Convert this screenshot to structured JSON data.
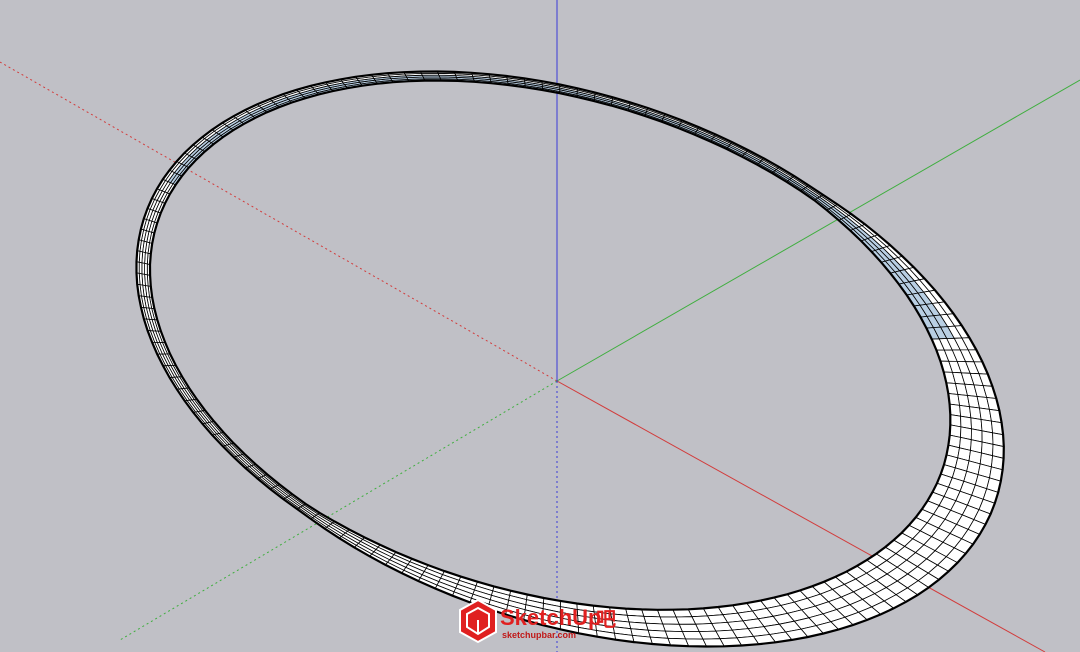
{
  "viewport": {
    "background": "#c0c0c6"
  },
  "axes": {
    "red": "#d23c3c",
    "green": "#3fae3f",
    "blue": "#3a3ad8"
  },
  "model": {
    "name": "twisted-ring",
    "edge_color": "#000000",
    "face_front": "#ffffff",
    "face_back": "#b9cfe3"
  },
  "watermark": {
    "brand": "SketchUp",
    "brand_suffix": "吧",
    "url": "sketchupbar.com",
    "logo_icon": "sketchup-logo-icon",
    "color": "#e02020"
  }
}
